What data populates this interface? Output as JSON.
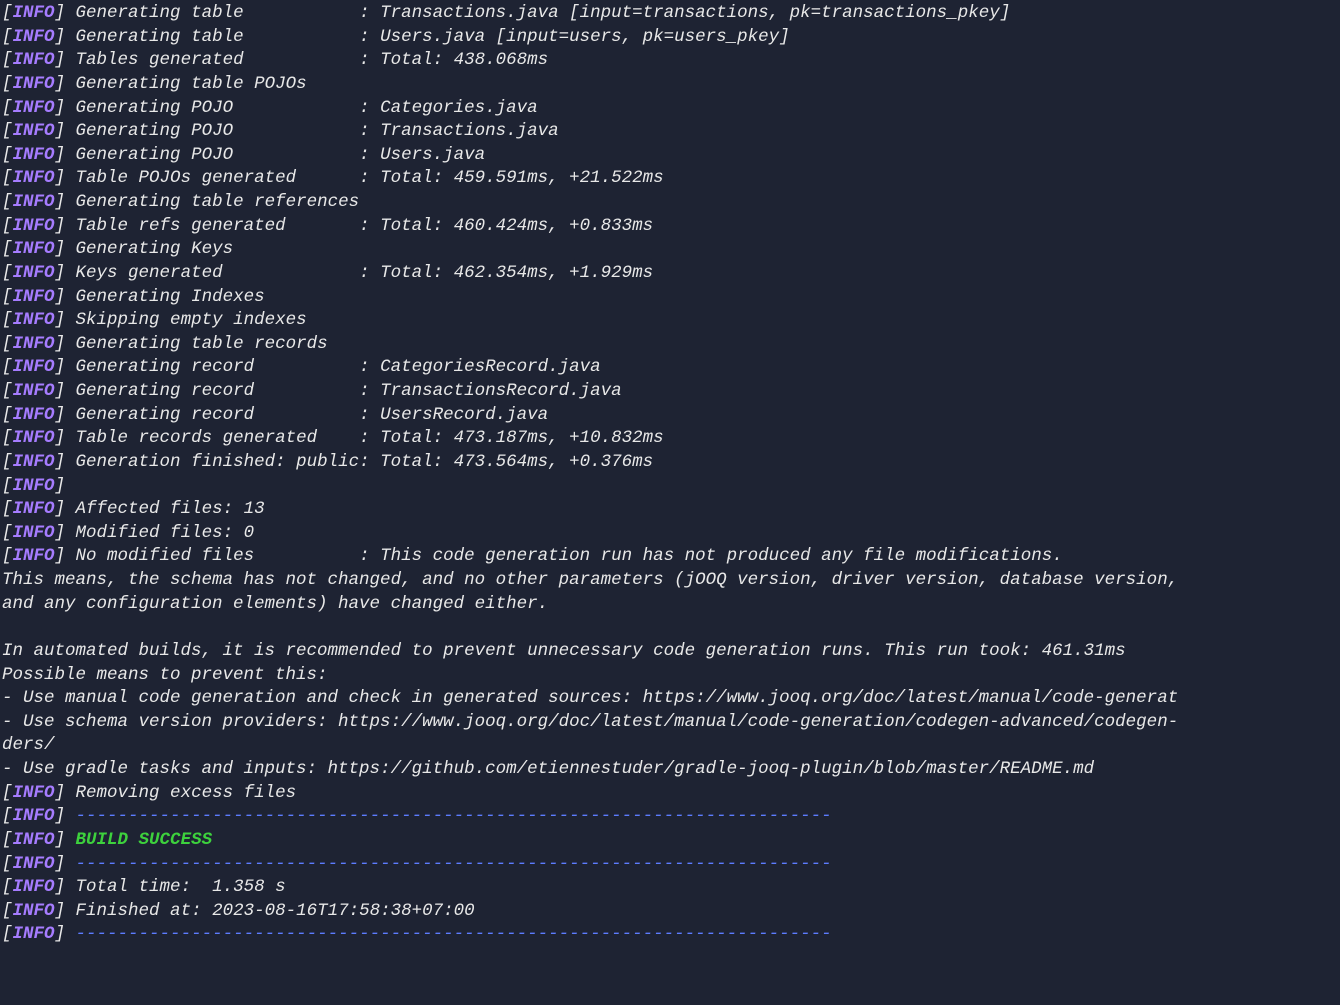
{
  "lines": [
    {
      "type": "info",
      "text": "Generating table           : Transactions.java [input=transactions, pk=transactions_pkey]"
    },
    {
      "type": "info",
      "text": "Generating table           : Users.java [input=users, pk=users_pkey]"
    },
    {
      "type": "info",
      "text": "Tables generated           : Total: 438.068ms"
    },
    {
      "type": "info",
      "text": "Generating table POJOs"
    },
    {
      "type": "info",
      "text": "Generating POJO            : Categories.java"
    },
    {
      "type": "info",
      "text": "Generating POJO            : Transactions.java"
    },
    {
      "type": "info",
      "text": "Generating POJO            : Users.java"
    },
    {
      "type": "info",
      "text": "Table POJOs generated      : Total: 459.591ms, +21.522ms"
    },
    {
      "type": "info",
      "text": "Generating table references"
    },
    {
      "type": "info",
      "text": "Table refs generated       : Total: 460.424ms, +0.833ms"
    },
    {
      "type": "info",
      "text": "Generating Keys"
    },
    {
      "type": "info",
      "text": "Keys generated             : Total: 462.354ms, +1.929ms"
    },
    {
      "type": "info",
      "text": "Generating Indexes"
    },
    {
      "type": "info",
      "text": "Skipping empty indexes"
    },
    {
      "type": "info",
      "text": "Generating table records"
    },
    {
      "type": "info",
      "text": "Generating record          : CategoriesRecord.java"
    },
    {
      "type": "info",
      "text": "Generating record          : TransactionsRecord.java"
    },
    {
      "type": "info",
      "text": "Generating record          : UsersRecord.java"
    },
    {
      "type": "info",
      "text": "Table records generated    : Total: 473.187ms, +10.832ms"
    },
    {
      "type": "info",
      "text": "Generation finished: public: Total: 473.564ms, +0.376ms"
    },
    {
      "type": "info",
      "text": ""
    },
    {
      "type": "info",
      "text": "Affected files: 13"
    },
    {
      "type": "info",
      "text": "Modified files: 0"
    },
    {
      "type": "info",
      "text": "No modified files          : This code generation run has not produced any file modifications."
    },
    {
      "type": "plain",
      "text": "This means, the schema has not changed, and no other parameters (jOOQ version, driver version, database version, "
    },
    {
      "type": "plain",
      "text": "and any configuration elements) have changed either."
    },
    {
      "type": "plain",
      "text": ""
    },
    {
      "type": "plain",
      "text": "In automated builds, it is recommended to prevent unnecessary code generation runs. This run took: 461.31ms"
    },
    {
      "type": "plain",
      "text": "Possible means to prevent this:"
    },
    {
      "type": "plain",
      "text": "- Use manual code generation and check in generated sources: https://www.jooq.org/doc/latest/manual/code-generat"
    },
    {
      "type": "plain",
      "text": "- Use schema version providers: https://www.jooq.org/doc/latest/manual/code-generation/codegen-advanced/codegen-"
    },
    {
      "type": "plain",
      "text": "ders/"
    },
    {
      "type": "plain",
      "text": "- Use gradle tasks and inputs: https://github.com/etiennestuder/gradle-jooq-plugin/blob/master/README.md"
    },
    {
      "type": "info",
      "text": "Removing excess files"
    },
    {
      "type": "info-blue",
      "text": "------------------------------------------------------------------------"
    },
    {
      "type": "info-green",
      "text": "BUILD SUCCESS"
    },
    {
      "type": "info-blue",
      "text": "------------------------------------------------------------------------"
    },
    {
      "type": "info",
      "text": "Total time:  1.358 s"
    },
    {
      "type": "info",
      "text": "Finished at: 2023-08-16T17:58:38+07:00"
    },
    {
      "type": "info-blue",
      "text": "------------------------------------------------------------------------"
    }
  ],
  "label_info": "INFO"
}
